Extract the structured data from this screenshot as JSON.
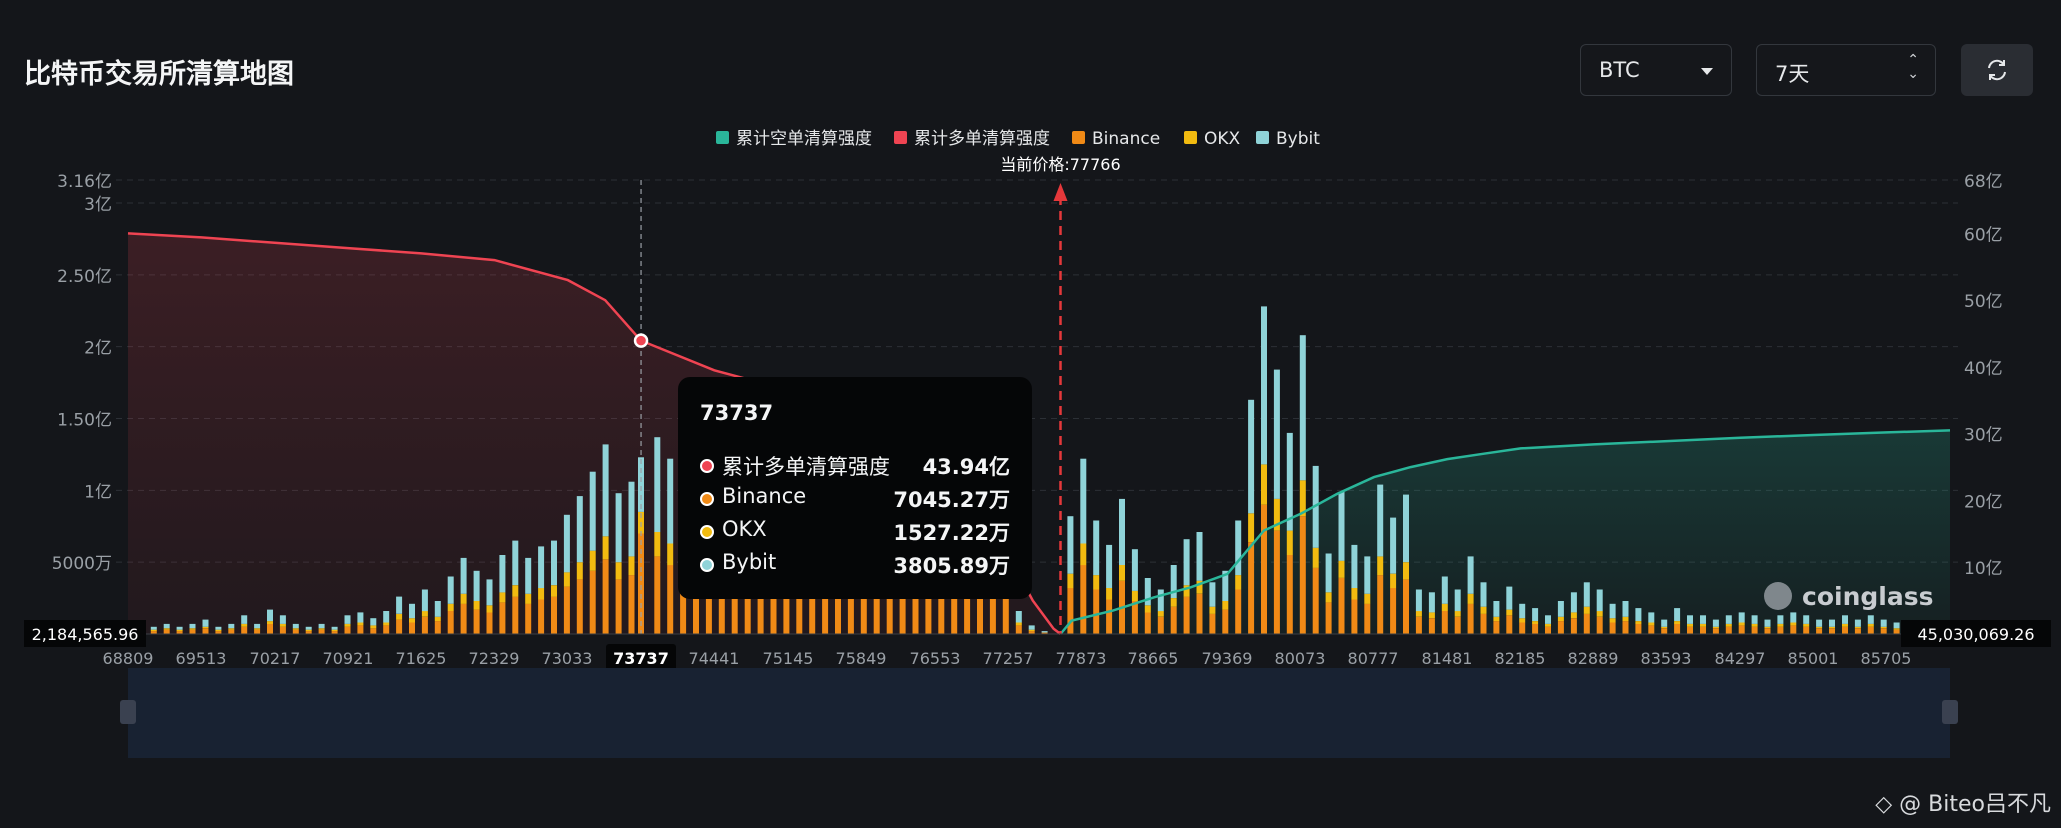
{
  "page": {
    "title": "比特币交易所清算地图",
    "coin_select": {
      "value": "BTC"
    },
    "range_select": {
      "value": "7天"
    },
    "watermark": "@ Biteo吕不凡"
  },
  "tooltip": {
    "title": "73737",
    "rows": [
      {
        "label": "累计多单清算强度",
        "value": "43.94亿",
        "color": "#ef4452"
      },
      {
        "label": "Binance",
        "value": "7045.27万",
        "color": "#f08a16"
      },
      {
        "label": "OKX",
        "value": "1527.22万",
        "color": "#f2bb10"
      },
      {
        "label": "Bybit",
        "value": "3805.89万",
        "color": "#8fd3d8"
      }
    ]
  },
  "chart_data": {
    "type": "bar",
    "legend": [
      {
        "name": "累计空单清算强度",
        "color": "#2ab69a"
      },
      {
        "name": "累计多单清算强度",
        "color": "#ef4452"
      },
      {
        "name": "Binance",
        "color": "#f08a16"
      },
      {
        "name": "OKX",
        "color": "#f2bb10"
      },
      {
        "name": "Bybit",
        "color": "#8fd3d8"
      }
    ],
    "legend_position": "top-center",
    "current_price_label": "当前价格:77766",
    "current_price": 77766,
    "x_tick_labels": [
      "68809",
      "69513",
      "70217",
      "70921",
      "71625",
      "72329",
      "73033",
      "73737",
      "74441",
      "75145",
      "75849",
      "76553",
      "77257",
      "77873",
      "78665",
      "79369",
      "80073",
      "80777",
      "81481",
      "82185",
      "82889",
      "83593",
      "84297",
      "85001",
      "85705"
    ],
    "x_range": [
      68809,
      86310
    ],
    "left_axis": {
      "ticks": [
        "0",
        "5000万",
        "1亿",
        "1.50亿",
        "2亿",
        "2.50亿",
        "3亿",
        "3.16亿"
      ],
      "range": [
        0,
        316000000
      ]
    },
    "right_axis": {
      "ticks": [
        "10亿",
        "20亿",
        "30亿",
        "40亿",
        "50亿",
        "60亿",
        "68亿"
      ],
      "range": [
        0,
        6800000000
      ]
    },
    "min_label": "2,184,565.96",
    "max_label": "45,030,069.26",
    "highlight_x": 73737,
    "brand_label": "coinglass",
    "grid": true,
    "bars": {
      "x": [
        68809,
        68933,
        69057,
        69181,
        69305,
        69429,
        69553,
        69677,
        69801,
        69925,
        70049,
        70173,
        70297,
        70421,
        70545,
        70669,
        70793,
        70917,
        71041,
        71165,
        71289,
        71413,
        71537,
        71661,
        71785,
        71909,
        72033,
        72157,
        72281,
        72405,
        72529,
        72653,
        72777,
        72901,
        73025,
        73149,
        73273,
        73397,
        73521,
        73645,
        73737,
        73893,
        74017,
        74141,
        74265,
        74389,
        74513,
        74637,
        74761,
        74885,
        75009,
        75133,
        75257,
        75381,
        75505,
        75629,
        75753,
        75877,
        76001,
        76125,
        76249,
        76373,
        76497,
        76621,
        76745,
        76869,
        76993,
        77117,
        77241,
        77365,
        77489,
        77613,
        77737,
        77861,
        77985,
        78109,
        78233,
        78357,
        78481,
        78605,
        78729,
        78853,
        78977,
        79101,
        79225,
        79349,
        79473,
        79597,
        79721,
        79845,
        79969,
        80093,
        80217,
        80341,
        80465,
        80589,
        80713,
        80837,
        80961,
        81085,
        81209,
        81333,
        81457,
        81581,
        81705,
        81829,
        81953,
        82077,
        82201,
        82325,
        82449,
        82573,
        82697,
        82821,
        82945,
        83069,
        83193,
        83317,
        83441,
        83565,
        83689,
        83813,
        83937,
        84061,
        84185,
        84309,
        84433,
        84557,
        84681,
        84805,
        84929,
        85053,
        85177,
        85301,
        85425,
        85549,
        85673,
        85797,
        85921,
        86045,
        86169,
        86293
      ],
      "binance": [
        2,
        3,
        2,
        3,
        2,
        3,
        4,
        2,
        3,
        5,
        3,
        7,
        5,
        3,
        2,
        3,
        2,
        5,
        6,
        4,
        6,
        10,
        8,
        12,
        9,
        16,
        21,
        17,
        15,
        22,
        26,
        21,
        24,
        26,
        33,
        38,
        44,
        52,
        38,
        41,
        70,
        54,
        48,
        51,
        45,
        48,
        47,
        42,
        44,
        46,
        43,
        45,
        41,
        40,
        43,
        44,
        42,
        45,
        44,
        40,
        44,
        43,
        42,
        44,
        43,
        41,
        40,
        43,
        41,
        6,
        2,
        1,
        0,
        32,
        48,
        31,
        24,
        37,
        23,
        15,
        12,
        19,
        26,
        28,
        14,
        17,
        31,
        64,
        90,
        72,
        55,
        82,
        46,
        22,
        39,
        24,
        21,
        41,
        32,
        38,
        12,
        11,
        16,
        12,
        21,
        14,
        9,
        13,
        8,
        7,
        5,
        9,
        11,
        14,
        12,
        8,
        9,
        7,
        6,
        4,
        7,
        5,
        5,
        4,
        5,
        6,
        5,
        4,
        5,
        6,
        5,
        4,
        4,
        5,
        4,
        5,
        4,
        3,
        3,
        2,
        3,
        3
      ],
      "okx": [
        1,
        1,
        1,
        1,
        1,
        1,
        1,
        1,
        1,
        2,
        1,
        2,
        2,
        1,
        1,
        1,
        1,
        2,
        2,
        2,
        2,
        4,
        3,
        4,
        3,
        5,
        7,
        6,
        5,
        7,
        8,
        7,
        8,
        8,
        10,
        12,
        14,
        16,
        12,
        13,
        15,
        17,
        15,
        16,
        14,
        15,
        14,
        13,
        14,
        14,
        13,
        14,
        13,
        12,
        13,
        14,
        13,
        14,
        14,
        12,
        14,
        13,
        13,
        14,
        13,
        13,
        12,
        13,
        13,
        2,
        1,
        0,
        0,
        10,
        15,
        10,
        8,
        11,
        7,
        5,
        4,
        6,
        8,
        9,
        5,
        6,
        10,
        20,
        28,
        22,
        17,
        25,
        14,
        7,
        12,
        8,
        7,
        13,
        10,
        12,
        4,
        4,
        5,
        4,
        7,
        5,
        3,
        4,
        3,
        2,
        2,
        3,
        4,
        5,
        4,
        3,
        3,
        2,
        2,
        1,
        2,
        2,
        2,
        1,
        2,
        2,
        2,
        1,
        2,
        2,
        2,
        1,
        1,
        2,
        1,
        2,
        1,
        1,
        1,
        1,
        1,
        1
      ],
      "bybit": [
        2,
        3,
        2,
        3,
        2,
        3,
        5,
        2,
        3,
        6,
        3,
        8,
        6,
        3,
        2,
        3,
        2,
        6,
        7,
        5,
        8,
        12,
        10,
        15,
        11,
        19,
        25,
        21,
        18,
        26,
        31,
        25,
        29,
        31,
        40,
        46,
        55,
        64,
        48,
        52,
        38,
        66,
        59,
        62,
        55,
        59,
        58,
        52,
        54,
        57,
        53,
        55,
        50,
        49,
        53,
        54,
        52,
        56,
        55,
        49,
        54,
        53,
        52,
        54,
        53,
        51,
        49,
        53,
        51,
        8,
        3,
        1,
        0,
        40,
        59,
        38,
        30,
        46,
        29,
        19,
        15,
        23,
        32,
        34,
        17,
        21,
        38,
        79,
        110,
        90,
        68,
        101,
        57,
        27,
        48,
        30,
        26,
        50,
        39,
        47,
        15,
        14,
        19,
        15,
        26,
        17,
        11,
        16,
        10,
        9,
        6,
        11,
        14,
        17,
        15,
        10,
        11,
        9,
        7,
        5,
        9,
        6,
        6,
        5,
        6,
        7,
        6,
        5,
        6,
        7,
        6,
        5,
        5,
        6,
        5,
        6,
        5,
        4,
        4,
        3,
        4,
        4
      ],
      "unit": "百万"
    },
    "long_cumulative": {
      "x": [
        68809,
        69513,
        70217,
        70921,
        71625,
        72329,
        73033,
        73393,
        73737,
        74441,
        74800,
        75145,
        75849,
        76553,
        76900,
        77257,
        77500,
        77700,
        77766
      ],
      "values": [
        6000,
        5940,
        5860,
        5780,
        5700,
        5600,
        5300,
        5000,
        4394,
        3950,
        3800,
        3600,
        3150,
        2500,
        1900,
        1200,
        500,
        80,
        0
      ],
      "unit": "百万"
    },
    "short_cumulative": {
      "x": [
        77766,
        77873,
        78269,
        78665,
        79017,
        79369,
        79721,
        80073,
        80425,
        80777,
        81129,
        81481,
        81833,
        82185,
        82889,
        83593,
        84297,
        85001,
        85705,
        86310
      ],
      "values": [
        0,
        200,
        350,
        550,
        700,
        900,
        1550,
        1800,
        2100,
        2350,
        2500,
        2620,
        2700,
        2780,
        2840,
        2890,
        2940,
        2980,
        3020,
        3050
      ],
      "unit": "百万"
    }
  }
}
